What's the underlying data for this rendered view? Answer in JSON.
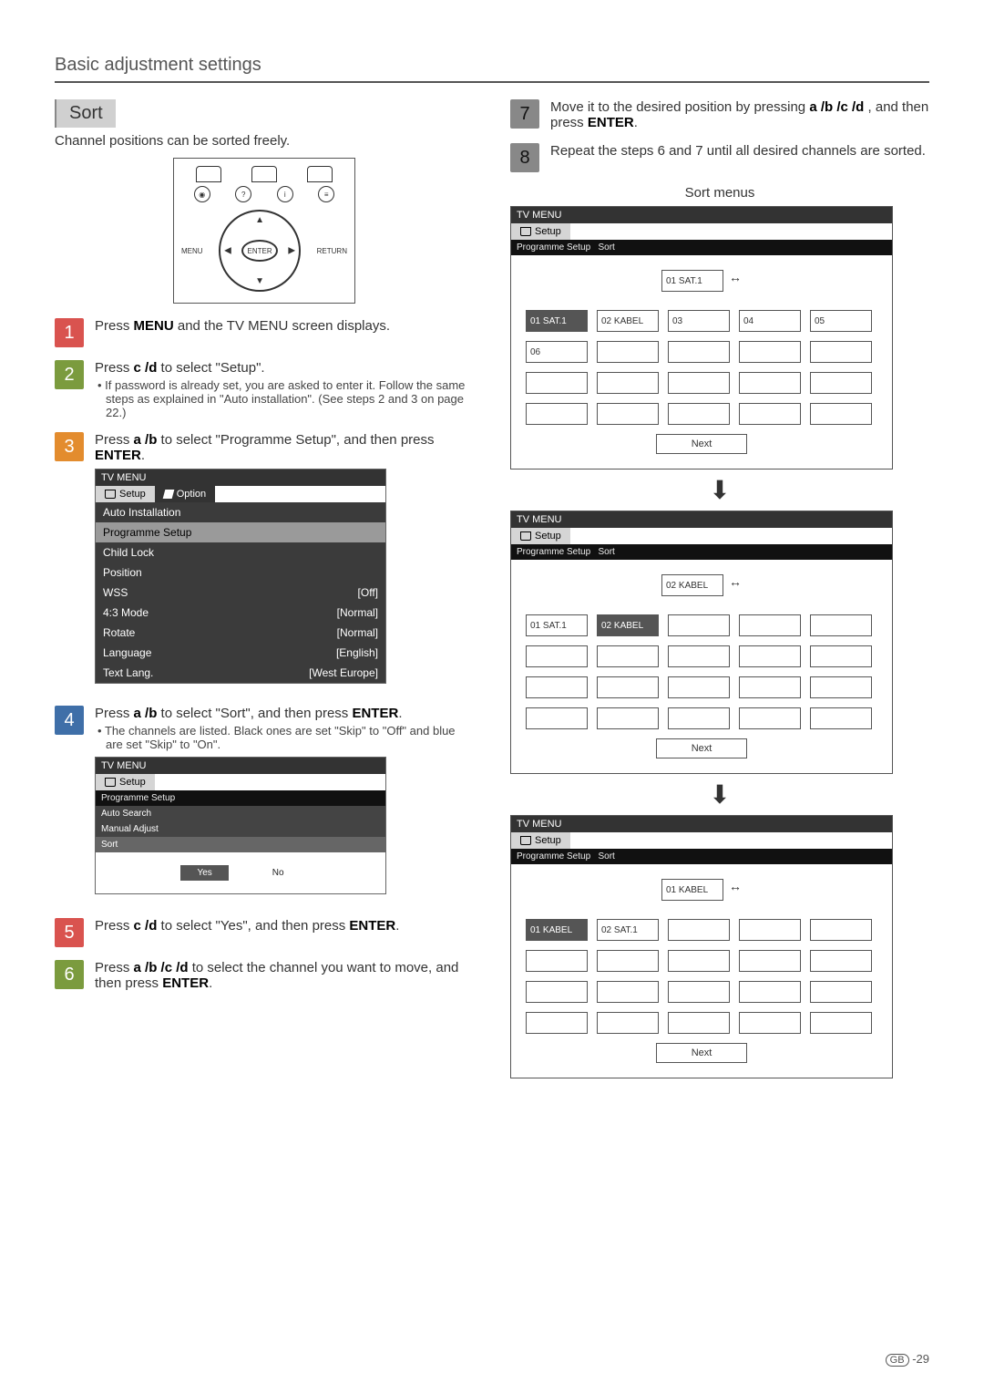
{
  "page": {
    "title": "Basic adjustment settings",
    "footer_region": "GB",
    "footer_page": "-29"
  },
  "sort": {
    "label": "Sort",
    "subtitle": "Channel positions can be sorted freely."
  },
  "remote": {
    "menu": "MENU",
    "return": "RETURN",
    "enter": "ENTER"
  },
  "steps": {
    "s1": {
      "num": "1",
      "text_a": "Press ",
      "text_b": "MENU",
      "text_c": " and the TV MENU screen displays."
    },
    "s2": {
      "num": "2",
      "text_a": "Press ",
      "keys": "c /d",
      "text_b": " to select \"Setup\".",
      "bullet": "If password is already set, you are asked to enter it. Follow the same steps as explained in \"Auto installation\". (See steps 2 and 3 on page 22.)"
    },
    "s3": {
      "num": "3",
      "text_a": "Press ",
      "keys": "a /b",
      "text_b": " to select \"Programme Setup\", and then press ",
      "enter": "ENTER",
      "text_c": "."
    },
    "s4": {
      "num": "4",
      "text_a": "Press ",
      "keys": "a /b",
      "text_b": " to select \"Sort\", and then press ",
      "enter": "ENTER",
      "text_c": ".",
      "bullet": "The channels are listed.  Black ones are set \"Skip\" to \"Off\" and blue are set \"Skip\" to \"On\"."
    },
    "s5": {
      "num": "5",
      "text_a": "Press ",
      "keys": "c /d",
      "text_b": " to select \"Yes\", and then press ",
      "enter": "ENTER",
      "text_c": "."
    },
    "s6": {
      "num": "6",
      "text_a": "Press ",
      "keys": "a /b /c /d",
      "text_b": " to select the channel you want to move, and then press ",
      "enter": "ENTER",
      "text_c": "."
    },
    "s7": {
      "num": "7",
      "text_a": "Move it to the desired position by pressing ",
      "keys": "a /b /c /d",
      "text_b": " , and then press ",
      "enter": "ENTER",
      "text_c": "."
    },
    "s8": {
      "num": "8",
      "text": "Repeat the steps 6 and 7 until all desired channels are sorted."
    }
  },
  "tvmenu1": {
    "title": "TV MENU",
    "tab_setup": "Setup",
    "tab_option": "Option",
    "rows": [
      {
        "label": "Auto Installation",
        "value": "",
        "style": "dark"
      },
      {
        "label": "Programme Setup",
        "value": "",
        "style": "sel"
      },
      {
        "label": "Child Lock",
        "value": "",
        "style": "dark"
      },
      {
        "label": "Position",
        "value": "",
        "style": "dark"
      },
      {
        "label": "WSS",
        "value": "[Off]",
        "style": "dark"
      },
      {
        "label": "4:3 Mode",
        "value": "[Normal]",
        "style": "dark"
      },
      {
        "label": "Rotate",
        "value": "[Normal]",
        "style": "dark"
      },
      {
        "label": "Language",
        "value": "[English]",
        "style": "dark"
      },
      {
        "label": "Text Lang.",
        "value": "[West Europe]",
        "style": "dark"
      }
    ]
  },
  "tvmenu2": {
    "title": "TV MENU",
    "tab_setup": "Setup",
    "breadcrumb": "Programme Setup",
    "items": [
      "Auto Search",
      "Manual Adjust",
      "Sort"
    ],
    "yes": "Yes",
    "no": "No"
  },
  "sortmenus": {
    "heading": "Sort menus",
    "title": "TV MENU",
    "tab_setup": "Setup",
    "crumb1": "Programme Setup",
    "crumb2": "Sort",
    "next": "Next",
    "panel1": {
      "highlight": "01  SAT.1",
      "grid": [
        "01  SAT.1",
        "02  KABEL",
        "03",
        "04",
        "05",
        "06"
      ]
    },
    "panel2": {
      "highlight": "02  KABEL",
      "grid": [
        "01  SAT.1",
        "02  KABEL"
      ]
    },
    "panel3": {
      "highlight": "01  KABEL",
      "grid": [
        "01  KABEL",
        "02  SAT.1"
      ]
    }
  }
}
